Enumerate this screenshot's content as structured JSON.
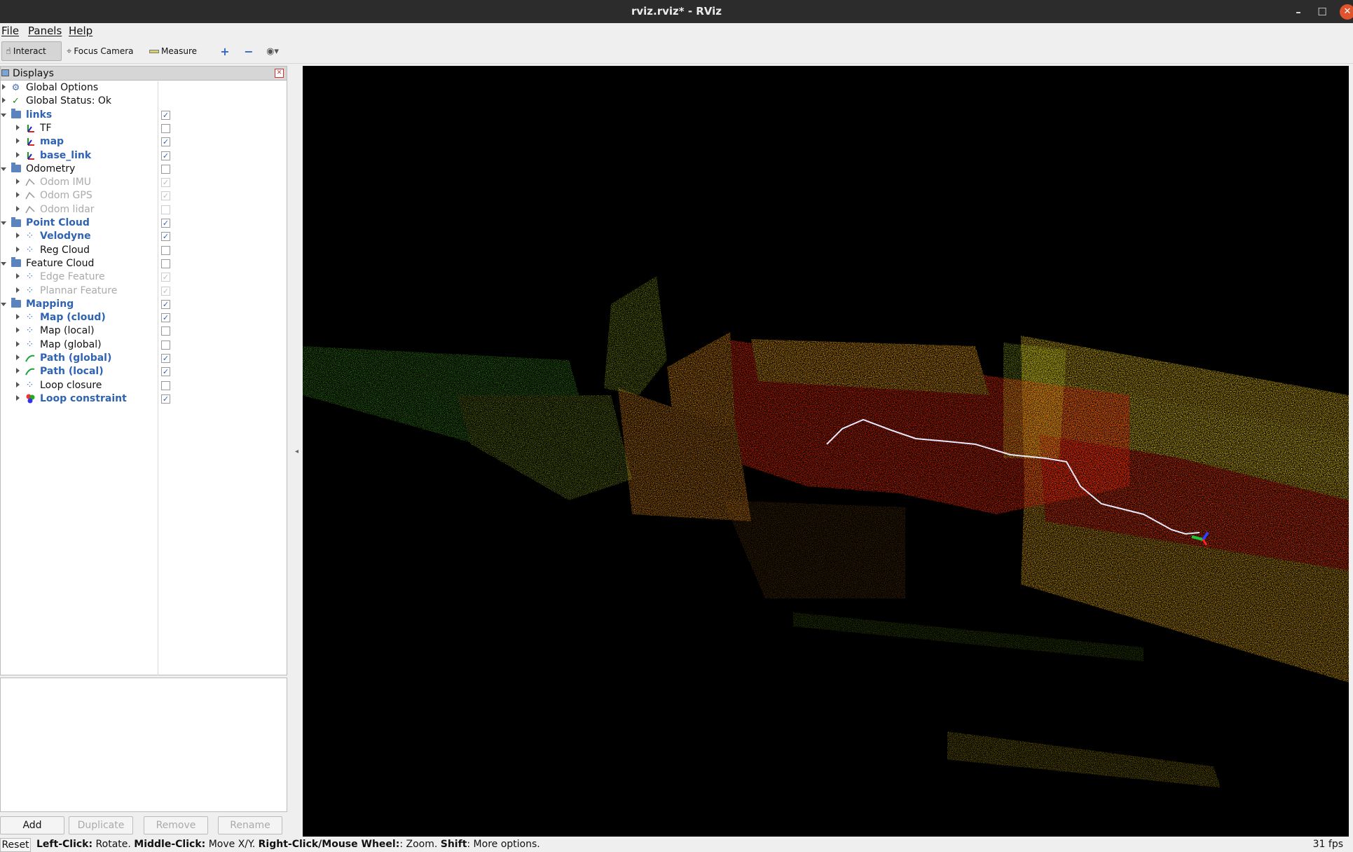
{
  "window": {
    "title": "rviz.rviz* - RViz"
  },
  "menu": {
    "file": "File",
    "panels": "Panels",
    "help": "Help"
  },
  "toolbar": {
    "interact": "Interact",
    "focus_camera": "Focus Camera",
    "measure": "Measure"
  },
  "displays": {
    "title": "Displays",
    "items": [
      {
        "label": "Global Options",
        "icon": "gear-icon",
        "style": "normal",
        "indent": 0,
        "expanded": false,
        "checkbox": null
      },
      {
        "label": "Global Status: Ok",
        "icon": "check-icon",
        "style": "normal",
        "indent": 0,
        "expanded": false,
        "checkbox": null
      },
      {
        "label": "links",
        "icon": "folder-icon",
        "style": "blue",
        "indent": 0,
        "expanded": true,
        "checkbox": "checked"
      },
      {
        "label": "TF",
        "icon": "axes-icon",
        "style": "normal",
        "indent": 1,
        "expanded": false,
        "checkbox": "unchecked"
      },
      {
        "label": "map",
        "icon": "axes-icon",
        "style": "blue",
        "indent": 1,
        "expanded": false,
        "checkbox": "checked"
      },
      {
        "label": "base_link",
        "icon": "axes-icon",
        "style": "blue",
        "indent": 1,
        "expanded": false,
        "checkbox": "checked"
      },
      {
        "label": "Odometry",
        "icon": "folder-icon",
        "style": "normal",
        "indent": 0,
        "expanded": true,
        "checkbox": "unchecked"
      },
      {
        "label": "Odom IMU",
        "icon": "odometry-icon",
        "style": "gray",
        "indent": 1,
        "expanded": false,
        "checkbox": "dim-checked"
      },
      {
        "label": "Odom GPS",
        "icon": "odometry-icon",
        "style": "gray",
        "indent": 1,
        "expanded": false,
        "checkbox": "dim-checked"
      },
      {
        "label": "Odom lidar",
        "icon": "odometry-icon",
        "style": "gray",
        "indent": 1,
        "expanded": false,
        "checkbox": "dim-unchecked"
      },
      {
        "label": "Point Cloud",
        "icon": "folder-icon",
        "style": "blue",
        "indent": 0,
        "expanded": true,
        "checkbox": "checked"
      },
      {
        "label": "Velodyne",
        "icon": "pointcloud-icon",
        "style": "blue",
        "indent": 1,
        "expanded": false,
        "checkbox": "checked"
      },
      {
        "label": "Reg Cloud",
        "icon": "pointcloud-icon",
        "style": "normal",
        "indent": 1,
        "expanded": false,
        "checkbox": "unchecked"
      },
      {
        "label": "Feature Cloud",
        "icon": "folder-icon",
        "style": "normal",
        "indent": 0,
        "expanded": true,
        "checkbox": "unchecked"
      },
      {
        "label": "Edge Feature",
        "icon": "pointcloud-icon",
        "style": "gray",
        "indent": 1,
        "expanded": false,
        "checkbox": "dim-checked"
      },
      {
        "label": "Plannar Feature",
        "icon": "pointcloud-icon",
        "style": "gray",
        "indent": 1,
        "expanded": false,
        "checkbox": "dim-checked"
      },
      {
        "label": "Mapping",
        "icon": "folder-icon",
        "style": "blue",
        "indent": 0,
        "expanded": true,
        "checkbox": "checked"
      },
      {
        "label": "Map (cloud)",
        "icon": "pointcloud-icon",
        "style": "blue",
        "indent": 1,
        "expanded": false,
        "checkbox": "checked"
      },
      {
        "label": "Map (local)",
        "icon": "pointcloud-icon",
        "style": "normal",
        "indent": 1,
        "expanded": false,
        "checkbox": "unchecked"
      },
      {
        "label": "Map (global)",
        "icon": "pointcloud-icon",
        "style": "normal",
        "indent": 1,
        "expanded": false,
        "checkbox": "unchecked"
      },
      {
        "label": "Path (global)",
        "icon": "path-icon",
        "style": "blue",
        "indent": 1,
        "expanded": false,
        "checkbox": "checked"
      },
      {
        "label": "Path (local)",
        "icon": "path-icon",
        "style": "blue",
        "indent": 1,
        "expanded": false,
        "checkbox": "checked"
      },
      {
        "label": "Loop closure",
        "icon": "pointcloud-icon",
        "style": "normal",
        "indent": 1,
        "expanded": false,
        "checkbox": "unchecked"
      },
      {
        "label": "Loop constraint",
        "icon": "marker-icon",
        "style": "blue",
        "indent": 1,
        "expanded": false,
        "checkbox": "checked"
      }
    ]
  },
  "buttons": {
    "add": "Add",
    "duplicate": "Duplicate",
    "remove": "Remove",
    "rename": "Rename"
  },
  "status": {
    "reset": "Reset",
    "segments": [
      {
        "text": "Left-Click:",
        "bold": true
      },
      {
        "text": " Rotate. ",
        "bold": false
      },
      {
        "text": "Middle-Click:",
        "bold": true
      },
      {
        "text": " Move X/Y. ",
        "bold": false
      },
      {
        "text": "Right-Click/Mouse Wheel:",
        "bold": true
      },
      {
        "text": ": Zoom. ",
        "bold": false
      },
      {
        "text": "Shift",
        "bold": true
      },
      {
        "text": ": More options.",
        "bold": false
      }
    ],
    "fps": "31 fps"
  }
}
